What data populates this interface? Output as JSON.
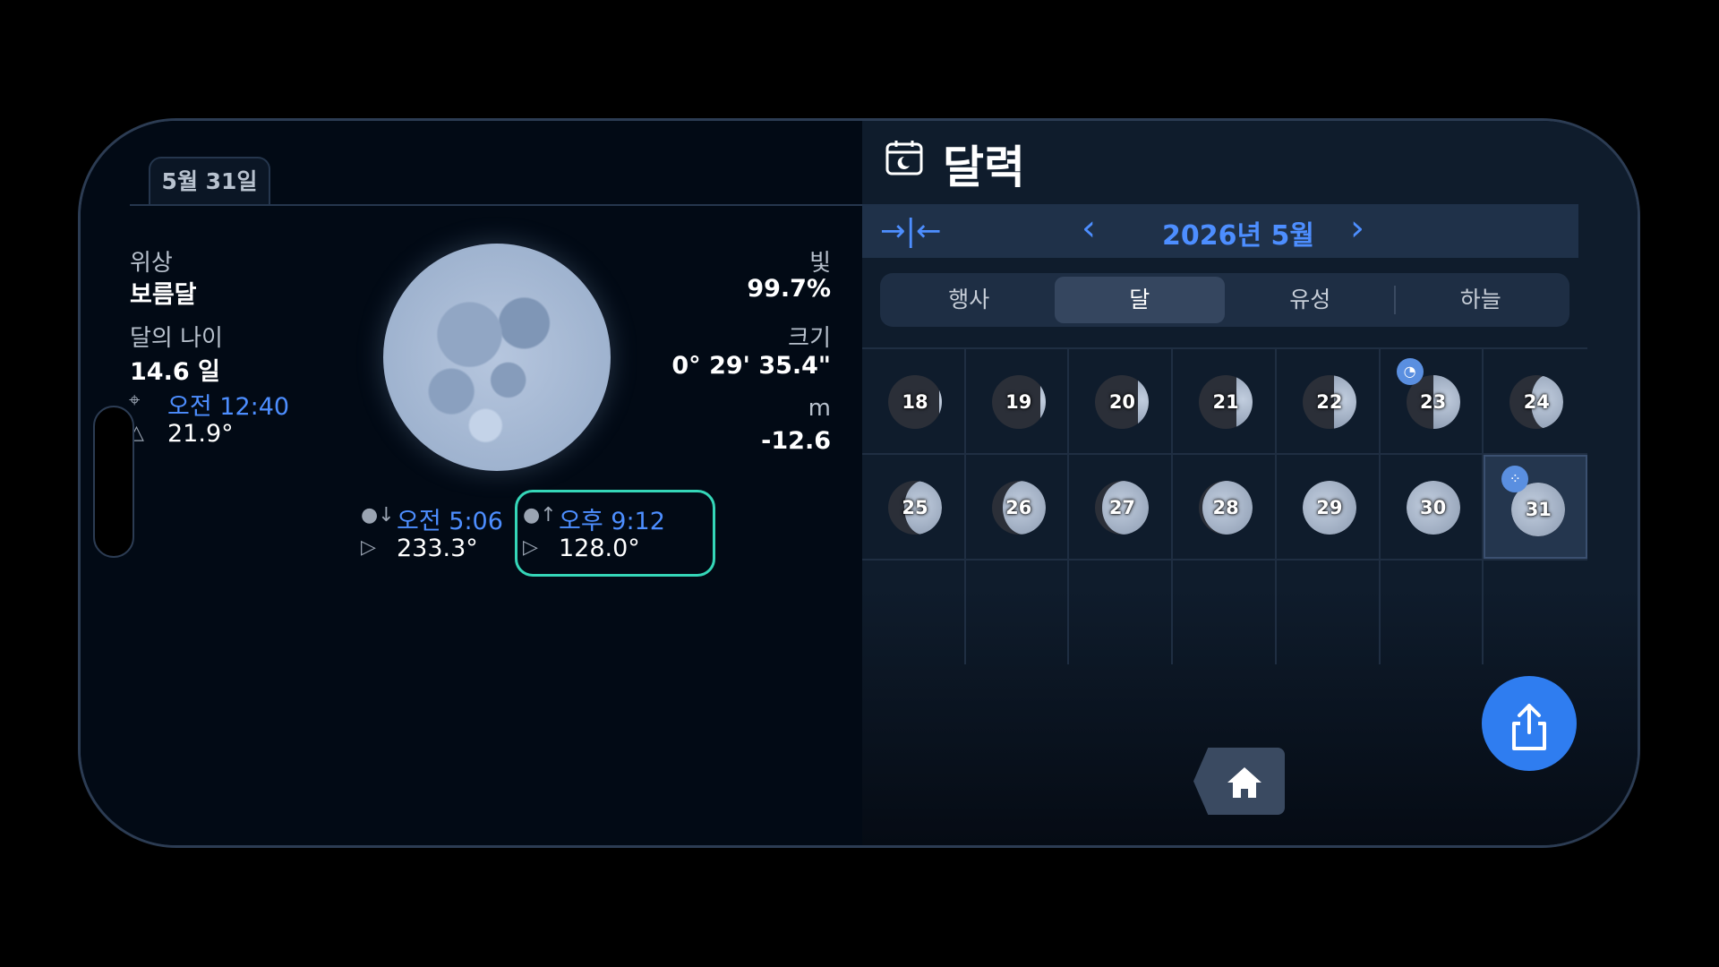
{
  "left": {
    "date_tab": "5월 31일",
    "phase_label": "위상",
    "phase_value": "보름달",
    "age_label": "달의 나이",
    "age_value": "14.6 일",
    "transit_time": "오전 12:40",
    "transit_altitude": "21.9°",
    "light_label": "빛",
    "light_value": "99.7%",
    "size_label": "크기",
    "size_value": "0° 29' 35.4\"",
    "mag_label": "m",
    "mag_value": "-12.6",
    "moonset_time": "오전 5:06",
    "moonset_azimuth": "233.3°",
    "moonrise_time": "오후 9:12",
    "moonrise_azimuth": "128.0°"
  },
  "calendar": {
    "title": "달력",
    "month": "2026년 5월",
    "tabs": [
      "행사",
      "달",
      "유성",
      "하늘"
    ],
    "active_tab": "달",
    "weeks": [
      [
        {
          "day": "18",
          "lit": 0.05
        },
        {
          "day": "19",
          "lit": 0.1
        },
        {
          "day": "20",
          "lit": 0.2
        },
        {
          "day": "21",
          "lit": 0.3
        },
        {
          "day": "22",
          "lit": 0.42
        },
        {
          "day": "23",
          "lit": 0.5,
          "badge": "first-quarter"
        },
        {
          "day": "24",
          "lit": 0.6
        }
      ],
      [
        {
          "day": "25",
          "lit": 0.7
        },
        {
          "day": "26",
          "lit": 0.8
        },
        {
          "day": "27",
          "lit": 0.88
        },
        {
          "day": "28",
          "lit": 0.93
        },
        {
          "day": "29",
          "lit": 0.97
        },
        {
          "day": "30",
          "lit": 0.99
        },
        {
          "day": "31",
          "lit": 1.0,
          "badge": "full-moon",
          "selected": true
        }
      ]
    ]
  }
}
